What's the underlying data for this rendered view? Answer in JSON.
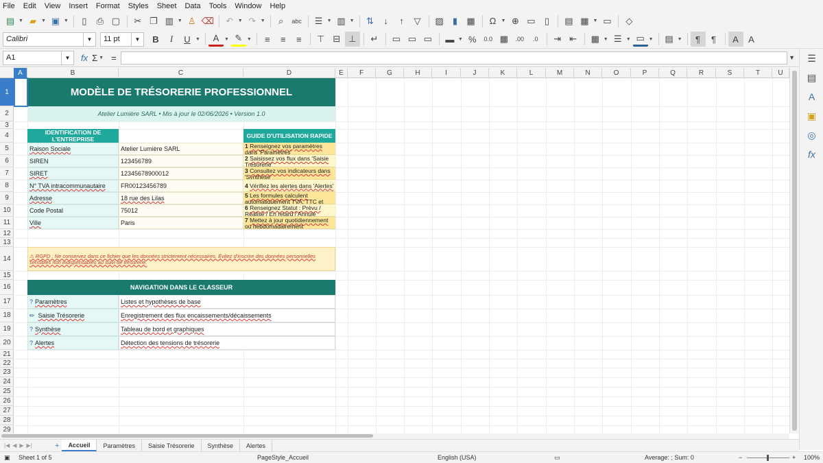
{
  "menu": [
    "File",
    "Edit",
    "View",
    "Insert",
    "Format",
    "Styles",
    "Sheet",
    "Data",
    "Tools",
    "Window",
    "Help"
  ],
  "font": {
    "name": "Calibri",
    "size": "11 pt"
  },
  "formula_bar": {
    "cell_ref": "A1",
    "fx": "fx",
    "sum": "Σ",
    "equals": "="
  },
  "columns": [
    "A",
    "B",
    "C",
    "D",
    "E",
    "F",
    "G",
    "H",
    "I",
    "J",
    "K",
    "L",
    "M",
    "N",
    "O",
    "P",
    "Q",
    "R",
    "S",
    "T",
    "U"
  ],
  "rows": [
    "1",
    "2",
    "3",
    "4",
    "5",
    "6",
    "7",
    "8",
    "9",
    "10",
    "11",
    "12",
    "13",
    "14",
    "15",
    "16",
    "17",
    "18",
    "19",
    "20",
    "21",
    "22",
    "23",
    "24",
    "25",
    "26",
    "27",
    "28",
    "29"
  ],
  "sheet": {
    "title": "MODÈLE DE TRÉSORERIE PROFESSIONNEL",
    "subtitle": "Atelier Lumière SARL  •  Mis à jour le 02/06/2026  •  Version 1.0",
    "identification_header": "IDENTIFICATION DE L'ENTREPRISE",
    "guide_header": "GUIDE D'UTILISATION RAPIDE",
    "identification": [
      {
        "label": "Raison Sociale",
        "value": "Atelier Lumière SARL"
      },
      {
        "label": "SIREN",
        "value": "123456789"
      },
      {
        "label": "SIRET",
        "value": "12345678900012"
      },
      {
        "label": "N° TVA intracommunautaire",
        "value": "FR00123456789"
      },
      {
        "label": "Adresse",
        "value": "18 rue des Lilas"
      },
      {
        "label": "Code Postal",
        "value": "75012"
      },
      {
        "label": "Ville",
        "value": "Paris"
      }
    ],
    "guide": [
      {
        "num": "1",
        "text": "Renseignez vos paramètres dans 'Paramètres'"
      },
      {
        "num": "2",
        "text": "Saisissez vos flux dans 'Saisie Trésorerie'"
      },
      {
        "num": "3",
        "text": "Consultez vos indicateurs dans 'Synthèse'"
      },
      {
        "num": "4",
        "text": "Vérifiez les alertes dans 'Alertes'"
      },
      {
        "num": "5",
        "text": "Les formules calculent automatiquement TVA, TTC et soldes"
      },
      {
        "num": "6",
        "text": "Renseignez Statut : Prévu / Réalisé / En retard / Annulé"
      },
      {
        "num": "7",
        "text": "Mettez à jour quotidiennement ou hebdomadairement"
      }
    ],
    "rgpd": "⚠  RGPD : Ne conservez dans ce fichier que les données strictement nécessaires. Évitez d'inscrire des données personnelles sensibles non indispensables au suivi de trésorerie.",
    "nav_header": "NAVIGATION DANS LE CLASSEUR",
    "nav": [
      {
        "icon": "?",
        "label": "Paramètres",
        "desc": "Listes et hypothèses de base"
      },
      {
        "icon": "✏",
        "label": "Saisie Trésorerie",
        "desc": "Enregistrement des flux encaissements/décaissements"
      },
      {
        "icon": "?",
        "label": "Synthèse",
        "desc": "Tableau de bord et graphiques"
      },
      {
        "icon": "?",
        "label": "Alertes",
        "desc": "Détection des tensions de trésorerie"
      }
    ]
  },
  "tabs": [
    "Accueil",
    "Paramètres",
    "Saisie Trésorerie",
    "Synthèse",
    "Alertes"
  ],
  "active_tab": "Accueil",
  "status": {
    "sheet": "Sheet 1 of 5",
    "page_style": "PageStyle_Accueil",
    "language": "English (USA)",
    "summary": "Average: ; Sum: 0",
    "zoom": "100%"
  }
}
